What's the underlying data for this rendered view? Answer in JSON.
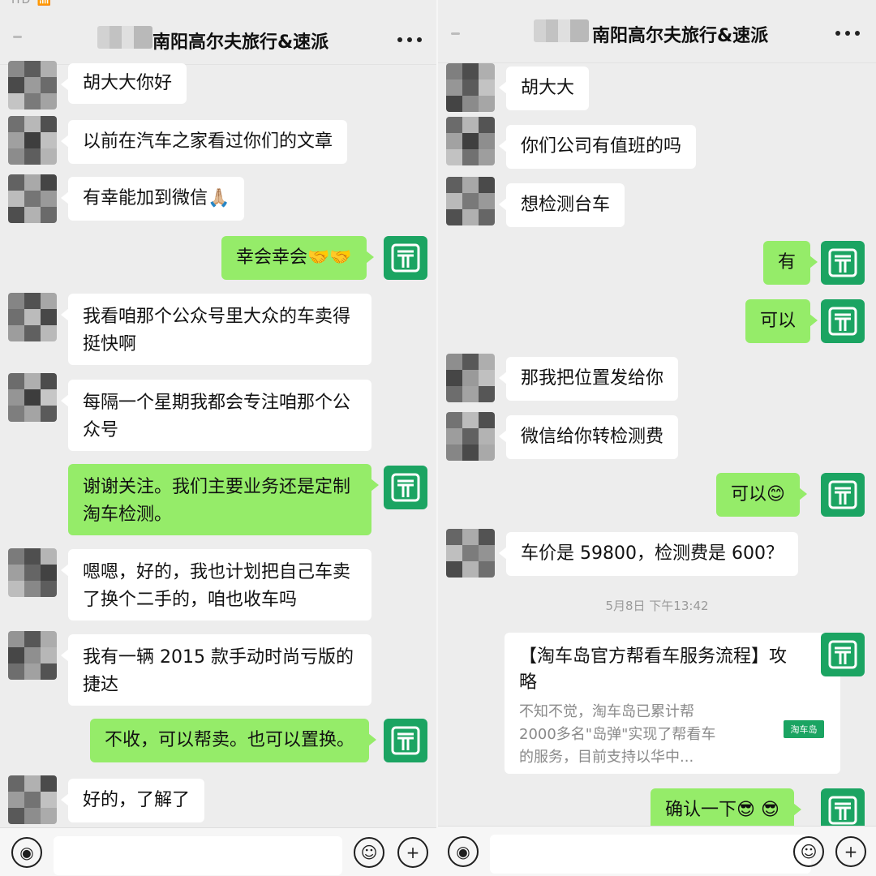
{
  "left": {
    "title": "南阳高尔夫旅行&速派",
    "status_text": "HD 📶 ",
    "messages": [
      {
        "from": "other",
        "text": "胡大大你好"
      },
      {
        "from": "other",
        "text": "以前在汽车之家看过你们的文章"
      },
      {
        "from": "other",
        "text": "有幸能加到微信",
        "emoji": "🙏🏼"
      },
      {
        "from": "me",
        "text": "幸会幸会",
        "emoji": "🤝🤝"
      },
      {
        "from": "other",
        "text": "我看咱那个公众号里大众的车卖得挺快啊"
      },
      {
        "from": "other",
        "text": "每隔一个星期我都会专注咱那个公众号"
      },
      {
        "from": "me",
        "text": "谢谢关注。我们主要业务还是定制淘车检测。"
      },
      {
        "from": "other",
        "text": "嗯嗯，好的，我也计划把自己车卖了换个二手的，咱也收车吗"
      },
      {
        "from": "other",
        "text": "我有一辆 2015 款手动时尚亏版的捷达"
      },
      {
        "from": "me",
        "text": "不收，可以帮卖。也可以置换。"
      },
      {
        "from": "other",
        "text": "好的，了解了"
      }
    ]
  },
  "right": {
    "title": "南阳高尔夫旅行&速派",
    "messages": [
      {
        "from": "other",
        "text": "胡大大"
      },
      {
        "from": "other",
        "text": "你们公司有值班的吗"
      },
      {
        "from": "other",
        "text": "想检测台车"
      },
      {
        "from": "me",
        "text": "有"
      },
      {
        "from": "me",
        "text": "可以"
      },
      {
        "from": "other",
        "text": "那我把位置发给你"
      },
      {
        "from": "other",
        "text": "微信给你转检测费"
      },
      {
        "from": "me",
        "text": "可以",
        "emoji": "😊"
      },
      {
        "from": "other",
        "text": "车价是 59800，检测费是 600？"
      },
      {
        "from": "me",
        "text": "确认一下",
        "emoji": "😎 😎"
      }
    ],
    "timestamp": "5月8日 下午13:42",
    "card": {
      "title": "【淘车岛官方帮看车服务流程】攻略",
      "desc": "不知不觉，淘车岛已累计帮2000多名\"岛弹\"实现了帮看车的服务，目前支持以华中...",
      "logo_text": "淘车岛"
    }
  },
  "icons": {
    "more": "more-icon",
    "voice": "voice-icon",
    "emoji": "emoji-icon",
    "plus": "plus-icon"
  },
  "colors": {
    "background": "#ededed",
    "bubble_in": "#ffffff",
    "bubble_out": "#95ec69",
    "avatar_brand": "#1ba462"
  }
}
